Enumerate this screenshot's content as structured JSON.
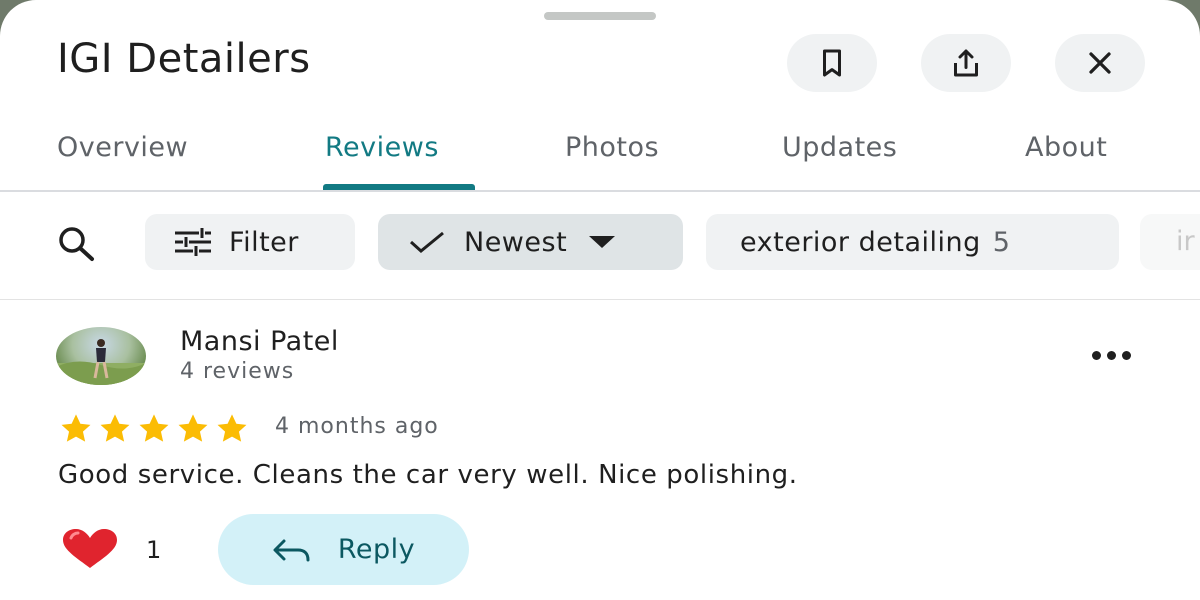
{
  "place": {
    "title": "IGI Detailers"
  },
  "header_actions": {
    "save_icon": "bookmark-icon",
    "share_icon": "share-icon",
    "close_icon": "close-icon"
  },
  "tabs": [
    {
      "label": "Overview",
      "active": false
    },
    {
      "label": "Reviews",
      "active": true
    },
    {
      "label": "Photos",
      "active": false
    },
    {
      "label": "Updates",
      "active": false
    },
    {
      "label": "About",
      "active": false
    }
  ],
  "filters": {
    "filter_label": "Filter",
    "sort_label": "Newest",
    "topic_label": "exterior detailing",
    "topic_count": "5",
    "partial_chip_label": "ir"
  },
  "review": {
    "author": "Mansi Patel",
    "author_reviews": "4 reviews",
    "rating": 5,
    "rating_max": 5,
    "date": "4 months ago",
    "text": "Good service. Cleans the car very well. Nice polishing.",
    "like_count": "1",
    "reply_label": "Reply"
  },
  "colors": {
    "accent": "#127a83",
    "star": "#fbbc04",
    "reply_bg": "#d3f1f8",
    "heart": "#e0242e"
  }
}
